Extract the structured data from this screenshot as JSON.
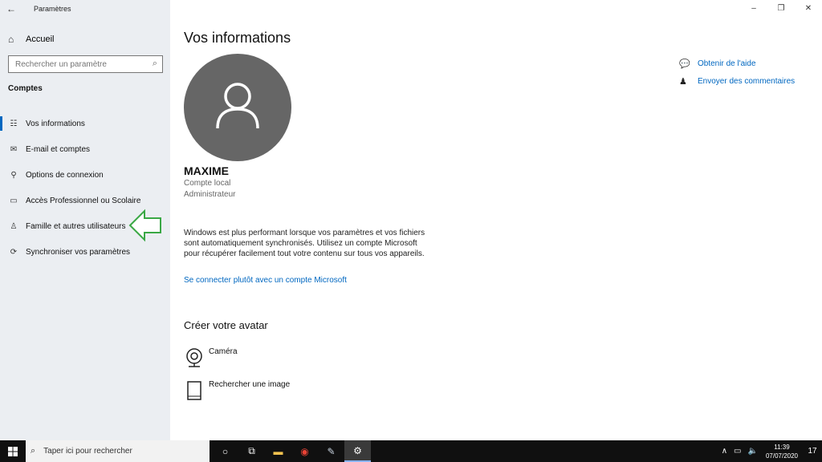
{
  "window": {
    "app_title": "Paramètres",
    "controls": [
      "–",
      "❐",
      "✕"
    ]
  },
  "sidebar": {
    "home_label": "Accueil",
    "search_placeholder": "Rechercher un paramètre",
    "section_title": "Comptes",
    "items": [
      {
        "label": "Vos informations",
        "icon": "person-card-icon",
        "active": true
      },
      {
        "label": "E-mail et comptes",
        "icon": "mail-icon"
      },
      {
        "label": "Options de connexion",
        "icon": "key-icon"
      },
      {
        "label": "Accès Professionnel ou Scolaire",
        "icon": "briefcase-icon"
      },
      {
        "label": "Famille et autres utilisateurs",
        "icon": "person-add-icon"
      },
      {
        "label": "Synchroniser vos paramètres",
        "icon": "sync-icon"
      }
    ]
  },
  "main": {
    "title": "Vos informations",
    "username": "MAXIME",
    "account_type": "Compte local",
    "role": "Administrateur",
    "description": "Windows est plus performant lorsque vos paramètres et vos fichiers sont automatiquement synchronisés. Utilisez un compte Microsoft pour récupérer facilement tout votre contenu sur tous vos appareils.",
    "ms_link": "Se connecter plutôt avec un compte Microsoft",
    "avatar_section_title": "Créer votre avatar",
    "camera_label": "Caméra",
    "browse_label": "Rechercher une image"
  },
  "help": {
    "get_help": "Obtenir de l'aide",
    "feedback": "Envoyer des commentaires"
  },
  "taskbar": {
    "search_placeholder": "Taper ici pour rechercher",
    "time": "11:39",
    "date": "07/07/2020",
    "notification_count": "17"
  },
  "colors": {
    "accent": "#0067c0",
    "sidebar_bg": "#ebeef2",
    "arrow": "#3aa845"
  }
}
